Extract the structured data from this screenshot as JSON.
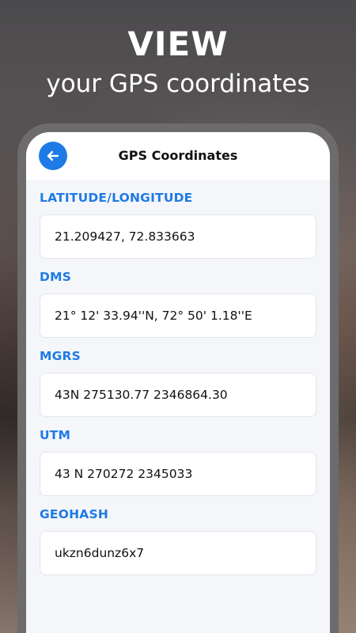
{
  "promo": {
    "headline": "VIEW",
    "subheadline": "your GPS coordinates"
  },
  "app_bar": {
    "title": "GPS Coordinates",
    "back_icon": "arrow-left-icon",
    "accent_color": "#1e7be6"
  },
  "sections": [
    {
      "label": "LATITUDE/LONGITUDE",
      "value": "21.209427, 72.833663"
    },
    {
      "label": "DMS",
      "value": "21° 12' 33.94''N, 72° 50' 1.18''E"
    },
    {
      "label": "MGRS",
      "value": "43N 275130.77 2346864.30"
    },
    {
      "label": "UTM",
      "value": "43 N 270272 2345033"
    },
    {
      "label": "GEOHASH",
      "value": "ukzn6dunz6x7"
    }
  ]
}
